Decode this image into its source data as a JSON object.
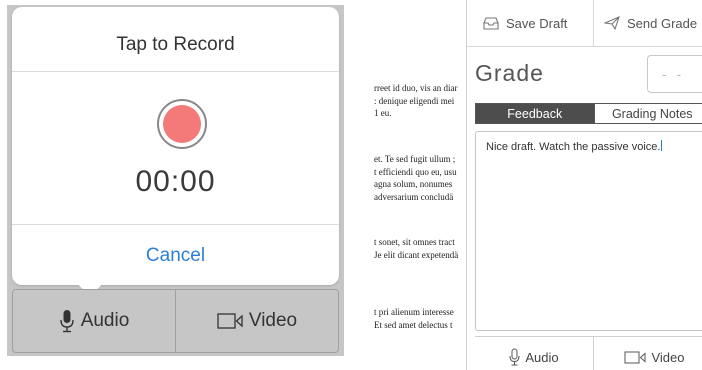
{
  "recorder": {
    "title": "Tap to Record",
    "timer": "00:00",
    "cancel_label": "Cancel",
    "record_color": "#f47a7a",
    "accent_color": "#2d7fd4",
    "media_buttons": {
      "audio_label": "Audio",
      "video_label": "Video"
    }
  },
  "document": {
    "paragraphs": [
      [
        "rreet id duo, vis an diar",
        ": denique eligendi mei",
        "1 eu."
      ],
      [
        "et. Te sed fugit ullum ;",
        "t efficiendi quo eu, usu",
        "agna solum, nonumes",
        "adversarium concludä"
      ],
      [
        "t sonet, sit omnes tract",
        "Je elit dicant expetendä"
      ],
      [
        "t pri alienum interesse",
        "Et sed amet delectus t"
      ]
    ]
  },
  "grading": {
    "toolbar": {
      "save_draft_label": "Save Draft",
      "send_grade_label": "Send Grade"
    },
    "grade_label": "Grade",
    "grade_value": "- -",
    "tabs": [
      {
        "label": "Feedback",
        "active": true
      },
      {
        "label": "Grading Notes",
        "active": false
      }
    ],
    "feedback_text": "Nice draft.  Watch the passive voice.",
    "media_buttons": {
      "audio_label": "Audio",
      "video_label": "Video"
    }
  }
}
